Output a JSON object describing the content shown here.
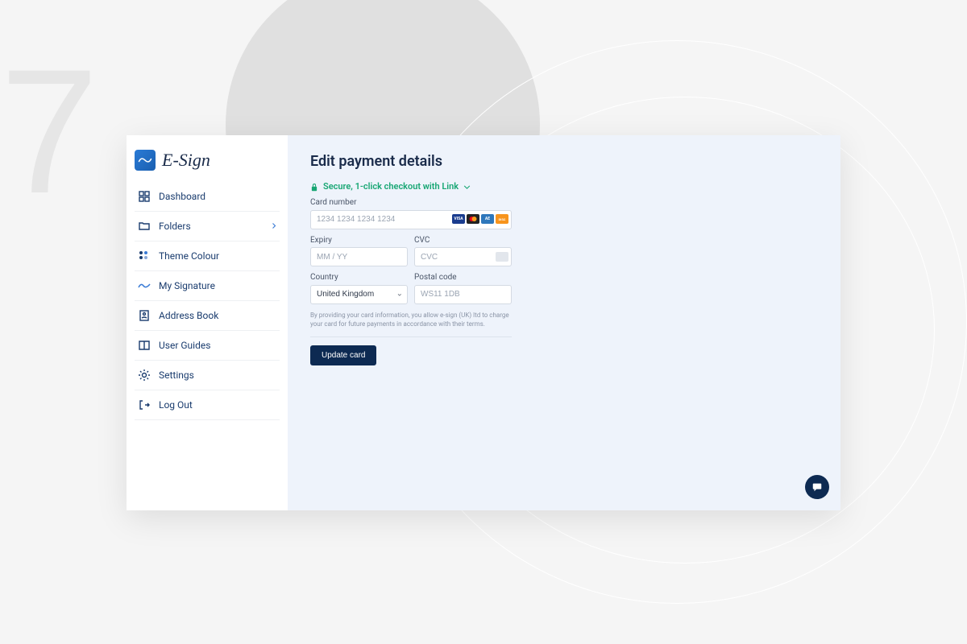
{
  "brand": {
    "name": "E-Sign"
  },
  "sidebar": {
    "items": [
      {
        "label": "Dashboard"
      },
      {
        "label": "Folders"
      },
      {
        "label": "Theme Colour"
      },
      {
        "label": "My Signature"
      },
      {
        "label": "Address Book"
      },
      {
        "label": "User Guides"
      },
      {
        "label": "Settings"
      },
      {
        "label": "Log Out"
      }
    ]
  },
  "page": {
    "title": "Edit payment details",
    "secure_text": "Secure, 1-click checkout with Link"
  },
  "form": {
    "card_number_label": "Card number",
    "card_number_placeholder": "1234 1234 1234 1234",
    "card_number_value": "",
    "expiry_label": "Expiry",
    "expiry_placeholder": "MM / YY",
    "expiry_value": "",
    "cvc_label": "CVC",
    "cvc_placeholder": "CVC",
    "cvc_value": "",
    "country_label": "Country",
    "country_value": "United Kingdom",
    "postal_label": "Postal code",
    "postal_placeholder": "WS11 1DB",
    "postal_value": "",
    "disclaimer": "By providing your card information, you allow e-sign (UK) ltd to charge your card for future payments in accordance with their terms.",
    "submit_label": "Update card"
  },
  "card_brands": [
    "visa",
    "mastercard",
    "amex",
    "discover"
  ]
}
